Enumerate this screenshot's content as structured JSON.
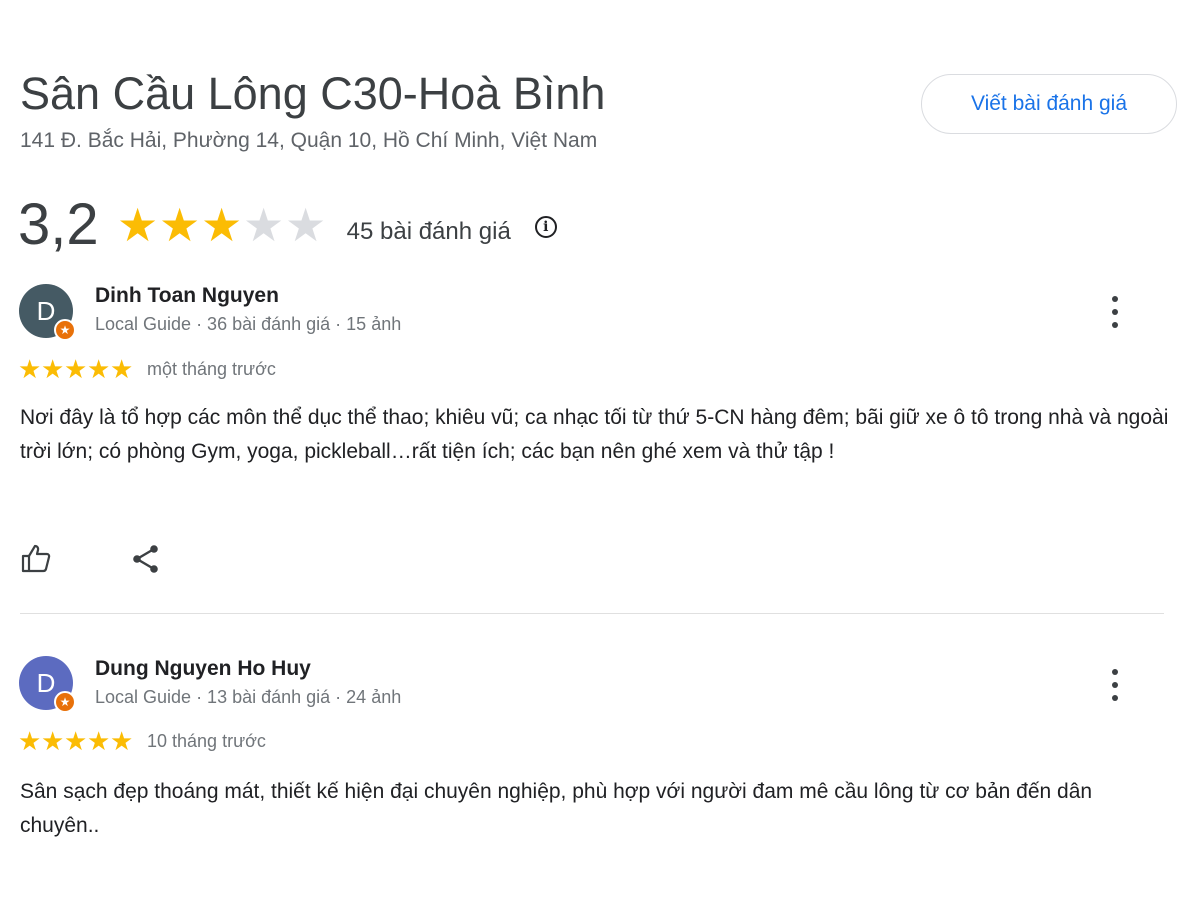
{
  "place": {
    "title": "Sân Cầu Lông C30-Hoà Bình",
    "address": "141 Đ. Bắc Hải, Phường 14, Quận 10, Hồ Chí Minh, Việt Nam",
    "write_review_label": "Viết bài đánh giá"
  },
  "summary": {
    "rating": "3,2",
    "stars_filled": 3,
    "stars_total": 5,
    "review_count": "45 bài đánh giá",
    "info_icon": "info-icon"
  },
  "colors": {
    "star_on": "#fbbc04",
    "star_off": "#dadce0",
    "accent": "#1a73e8",
    "badge": "#e8710a"
  },
  "reviews": [
    {
      "avatar_letter": "D",
      "avatar_color": "#455a64",
      "name": "Dinh Toan Nguyen",
      "meta": "Local Guide · 36 bài đánh giá · 15 ảnh",
      "stars": 5,
      "time": "một tháng trước",
      "text": "Nơi đây là tổ hợp các môn thể dục thể thao; khiêu vũ; ca nhạc tối từ thứ 5-CN hàng đêm; bãi giữ xe ô tô trong nhà và ngoài trời lớn; có phòng Gym, yoga, pickleball…rất tiện ích; các bạn nên ghé xem và thử tập !"
    },
    {
      "avatar_letter": "D",
      "avatar_color": "#5c6bc0",
      "name": "Dung Nguyen Ho Huy",
      "meta": "Local Guide · 13 bài đánh giá · 24 ảnh",
      "stars": 5,
      "time": "10 tháng trước",
      "text": "Sân sạch đẹp thoáng mát, thiết kế hiện đại chuyên nghiệp, phù hợp với người đam mê cầu lông từ cơ bản đến dân chuyên.."
    }
  ]
}
